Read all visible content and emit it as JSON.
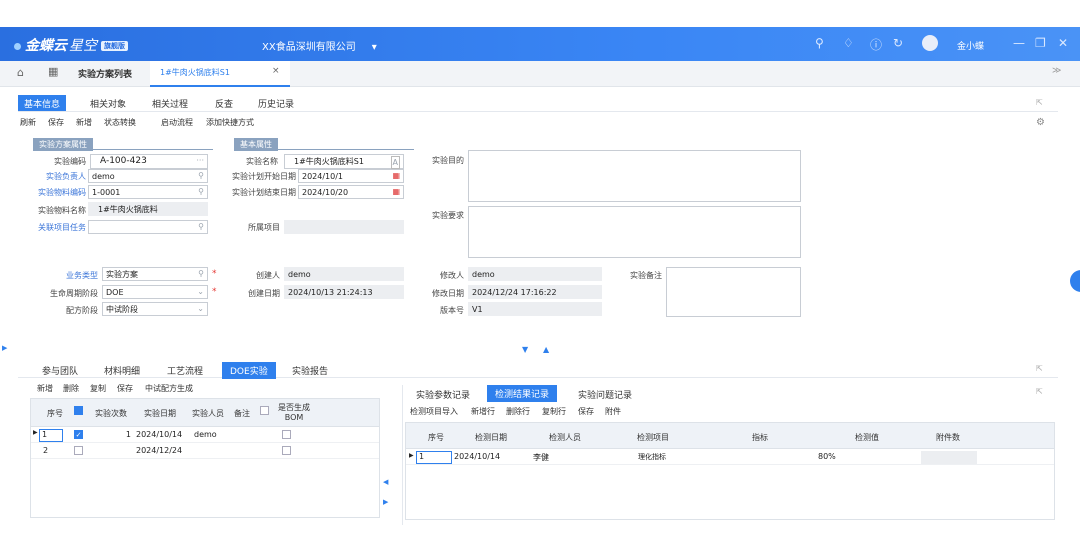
{
  "topbar": {
    "logo": "金蝶云",
    "logo_sub": "星空",
    "logo_badge": "旗舰版",
    "company": "XX食品深圳有限公司",
    "company_caret": "▾",
    "username": "金小蝶"
  },
  "tabbar": {
    "tab1": "实验方案列表",
    "tab2": "1#牛肉火锅底料S1",
    "close": "×",
    "collapse": "≫"
  },
  "subtabs": [
    "基本信息",
    "相关对象",
    "相关过程",
    "反查",
    "历史记录"
  ],
  "toolbar": [
    "刷新",
    "保存",
    "新增",
    "状态转换",
    "启动流程",
    "添加快捷方式"
  ],
  "sections": {
    "scheme": "实验方案属性",
    "basic": "基本属性"
  },
  "fields": {
    "code_label": "实验编码",
    "code": "A-100-423",
    "owner_label": "实验负责人",
    "owner": "demo",
    "material_code_label": "实验物料编码",
    "material_code": "1-0001",
    "material_name_label": "实验物料名称",
    "material_name": "1#牛肉火锅底料",
    "task_label": "关联项目任务",
    "task": "",
    "name_label": "实验名称",
    "name": "1#牛肉火锅底料S1",
    "start_label": "实验计划开始日期",
    "start": "2024/10/1",
    "end_label": "实验计划结束日期",
    "end": "2024/10/20",
    "project_label": "所属项目",
    "project": "",
    "purpose_label": "实验目的",
    "requirement_label": "实验要求",
    "biz_type_label": "业务类型",
    "biz_type": "实验方案",
    "lifecycle_label": "生命周期阶段",
    "lifecycle": "DOE",
    "recipe_label": "配方阶段",
    "recipe": "中试阶段",
    "creator_label": "创建人",
    "creator": "demo",
    "created_label": "创建日期",
    "created": "2024/10/13 21:24:13",
    "modifier_label": "修改人",
    "modifier": "demo",
    "modified_label": "修改日期",
    "modified": "2024/12/24 17:16:22",
    "version_label": "版本号",
    "version": "V1",
    "note_label": "实验备注"
  },
  "bottom_tabs": [
    "参与团队",
    "材料明细",
    "工艺流程",
    "DOE实验",
    "实验报告"
  ],
  "left_toolbar": [
    "新增",
    "删除",
    "复制",
    "保存",
    "中试配方生成"
  ],
  "left_grid": {
    "headers": [
      "序号",
      "实验次数",
      "实验日期",
      "实验人员",
      "备注",
      "是否生成BOM"
    ],
    "rows": [
      {
        "seq": "1",
        "count": "1",
        "date": "2024/10/14",
        "person": "demo"
      },
      {
        "seq": "2",
        "count": "",
        "date": "2024/12/24",
        "person": ""
      }
    ]
  },
  "right_tabs": [
    "实验参数记录",
    "检测结果记录",
    "实验问题记录"
  ],
  "right_toolbar": [
    "检测项目导入",
    "新增行",
    "删除行",
    "复制行",
    "保存",
    "附件"
  ],
  "right_grid": {
    "headers": [
      "序号",
      "检测日期",
      "检测人员",
      "检测项目",
      "指标",
      "检测值",
      "附件数"
    ],
    "rows": [
      {
        "seq": "1",
        "date": "2024/10/14",
        "person": "李健",
        "item": "理化指标",
        "index": "",
        "value": "80%",
        "attach": ""
      }
    ]
  }
}
